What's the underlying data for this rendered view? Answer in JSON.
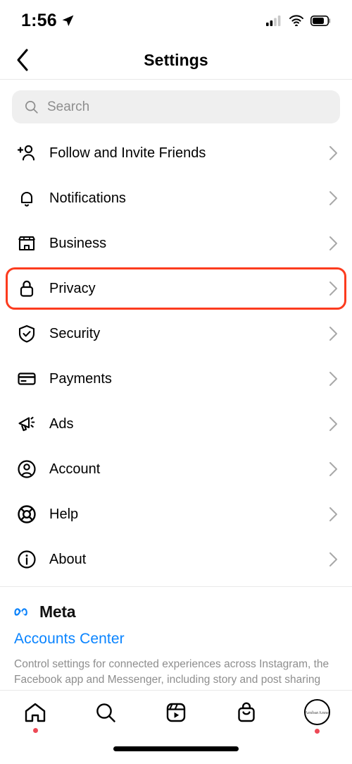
{
  "status_bar": {
    "time": "1:56",
    "location_icon": "location-arrow-icon",
    "signal_icon": "cellular-signal-icon",
    "wifi_icon": "wifi-icon",
    "battery_icon": "battery-icon",
    "signal_bars_filled": 2,
    "signal_bars_total": 4,
    "battery_level_pct": 72
  },
  "header": {
    "back_icon": "chevron-left-icon",
    "title": "Settings"
  },
  "search": {
    "icon": "search-icon",
    "placeholder": "Search",
    "value": ""
  },
  "settings_list": [
    {
      "label": "Follow and Invite Friends",
      "icon": "person-add-icon",
      "highlighted": false
    },
    {
      "label": "Notifications",
      "icon": "bell-icon",
      "highlighted": false
    },
    {
      "label": "Business",
      "icon": "storefront-icon",
      "highlighted": false
    },
    {
      "label": "Privacy",
      "icon": "lock-icon",
      "highlighted": true
    },
    {
      "label": "Security",
      "icon": "shield-check-icon",
      "highlighted": false
    },
    {
      "label": "Payments",
      "icon": "credit-card-icon",
      "highlighted": false
    },
    {
      "label": "Ads",
      "icon": "megaphone-icon",
      "highlighted": false
    },
    {
      "label": "Account",
      "icon": "user-circle-icon",
      "highlighted": false
    },
    {
      "label": "Help",
      "icon": "lifebuoy-icon",
      "highlighted": false
    },
    {
      "label": "About",
      "icon": "info-circle-icon",
      "highlighted": false
    }
  ],
  "meta_section": {
    "logo_icon": "meta-infinity-icon",
    "brand": "Meta",
    "link": "Accounts Center",
    "description": "Control settings for connected experiences across Instagram, the Facebook app and Messenger, including story and post sharing and loggi…"
  },
  "tab_bar": [
    {
      "name": "home",
      "icon": "home-icon",
      "badge_dot": true
    },
    {
      "name": "search",
      "icon": "search-icon",
      "badge_dot": false
    },
    {
      "name": "reels",
      "icon": "reels-icon",
      "badge_dot": false
    },
    {
      "name": "shop",
      "icon": "shopping-bag-icon",
      "badge_dot": false
    },
    {
      "name": "profile",
      "icon": "profile-avatar-icon",
      "badge_dot": true,
      "avatar_text": "AmbarAnne"
    }
  ],
  "colors": {
    "highlight_red": "#fc3b1e",
    "link_blue": "#0a84ff",
    "meta_blue": "#0a82fb",
    "badge_red": "#ed4956",
    "search_bg": "#efefef",
    "muted_text": "#8e8e8e",
    "chevron_gray": "#a8a8a8"
  }
}
